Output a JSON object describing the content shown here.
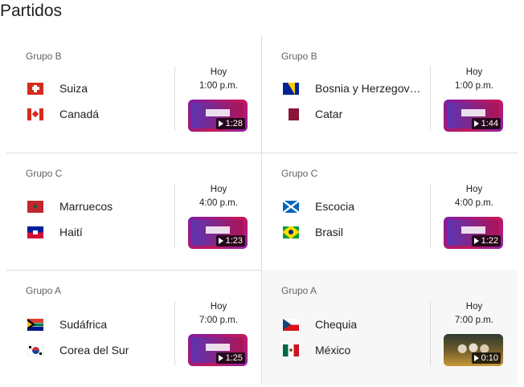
{
  "title": "Partidos",
  "matches": [
    {
      "group": "Grupo B",
      "team1": "Suiza",
      "team2": "Canadá",
      "day": "Hoy",
      "time": "1:00 p.m.",
      "duration": "1:28"
    },
    {
      "group": "Grupo B",
      "team1": "Bosnia y Herzegov…",
      "team2": "Catar",
      "day": "Hoy",
      "time": "1:00 p.m.",
      "duration": "1:44"
    },
    {
      "group": "Grupo C",
      "team1": "Marruecos",
      "team2": "Haití",
      "day": "Hoy",
      "time": "4:00 p.m.",
      "duration": "1:23"
    },
    {
      "group": "Grupo C",
      "team1": "Escocia",
      "team2": "Brasil",
      "day": "Hoy",
      "time": "4:00 p.m.",
      "duration": "1:22"
    },
    {
      "group": "Grupo A",
      "team1": "Sudáfrica",
      "team2": "Corea del Sur",
      "day": "Hoy",
      "time": "7:00 p.m.",
      "duration": "1:25"
    },
    {
      "group": "Grupo A",
      "team1": "Chequia",
      "team2": "México",
      "day": "Hoy",
      "time": "7:00 p.m.",
      "duration": "0:10"
    }
  ],
  "icons": {
    "flags": [
      "switzerland-flag",
      "canada-flag",
      "bosnia-flag",
      "qatar-flag",
      "morocco-flag",
      "haiti-flag",
      "scotland-flag",
      "brazil-flag",
      "south-africa-flag",
      "south-korea-flag",
      "czechia-flag",
      "mexico-flag"
    ],
    "play": "play-icon"
  },
  "colors": {
    "divider": "#dadce0",
    "muted_text": "#5f6368",
    "thumb_accent": "#8e24aa"
  }
}
